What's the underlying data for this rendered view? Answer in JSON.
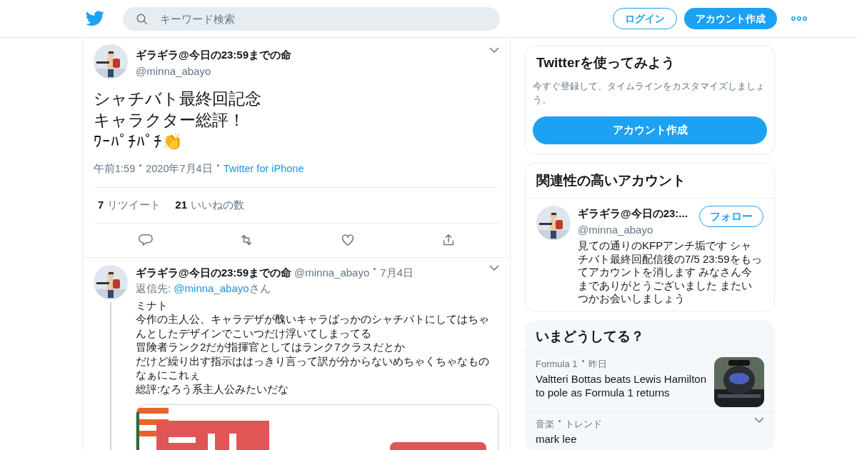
{
  "header": {
    "search": {
      "placeholder": "キーワード検索"
    },
    "login": "ログイン",
    "signup": "アカウント作成"
  },
  "main_tweet": {
    "name": "ギラギラ@今日の23:59までの命",
    "handle": "@minna_abayo",
    "lines": [
      "シャチバト最終回記念",
      "キャラクター総評！",
      "ﾜｰﾊﾟﾁﾊﾟﾁ👏"
    ],
    "time": "午前1:59",
    "date": "2020年7月4日",
    "source": "Twitter for iPhone",
    "stats": [
      {
        "count": "7",
        "label": "リツイート"
      },
      {
        "count": "21",
        "label": "いいねの数"
      }
    ]
  },
  "reply_tweet": {
    "name": "ギラギラ@今日の23:59までの命",
    "handle": "@minna_abayo",
    "date": "7月4日",
    "reply_prefix": "返信先: ",
    "reply_to": "@minna_abayo",
    "reply_suffix": "さん",
    "lines": [
      "ミナト",
      "今作の主人公、キャラデザが醜いキャラばっかのシャチバトにしてはちゃんとしたデザインでこいつだけ浮いてしまってる",
      "冒険者ランク2だが指揮官としてはランク7クラスだとか",
      "だけど繰り出す指示ははっきり言って訳が分からないめちゃくちゃなものなぁにこれぇ",
      "総評:なろう系主人公みたいだな"
    ]
  },
  "signup_card": {
    "title": "Twitterを使ってみよう",
    "text": "今すぐ登録して、タイムラインをカスタマイズしましょう。",
    "button": "アカウント作成"
  },
  "related_card": {
    "title": "関連性の高いアカウント",
    "account": {
      "name": "ギラギラ@今日の23:...",
      "handle": "@minna_abayo",
      "follow": "フォロー",
      "bio": "見ての通りのKFPアンチ垢です シャチバト最終回配信後の7/5 23:59をもってアカウントを消します みなさん今までありがとうございました またいつかお会いしましょう"
    }
  },
  "trends_card": {
    "title": "いまどうしてる？",
    "items": [
      {
        "kind": "news",
        "meta": "Formula 1",
        "time": "昨日",
        "headline": "Valtteri Bottas beats Lewis Hamilton to pole as Formula 1 returns"
      },
      {
        "kind": "trend",
        "meta": "音楽",
        "time": "トレンド",
        "headline": "mark lee"
      }
    ]
  }
}
